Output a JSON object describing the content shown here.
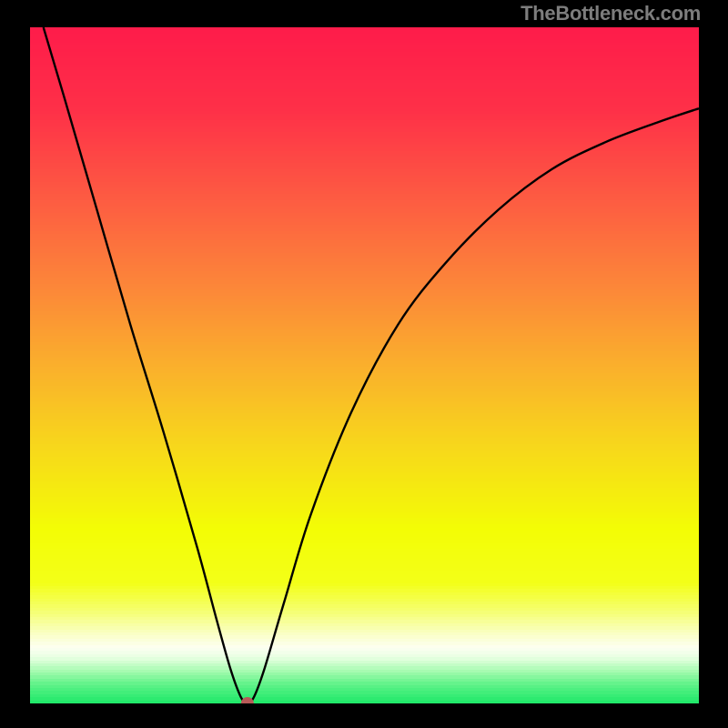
{
  "watermark": "TheBottleneck.com",
  "chart_data": {
    "type": "line",
    "title": "",
    "xlabel": "",
    "ylabel": "",
    "xlim": [
      0,
      100
    ],
    "ylim": [
      0,
      100
    ],
    "grid": false,
    "legend": false,
    "series": [
      {
        "name": "bottleneck-curve",
        "x": [
          2,
          5,
          10,
          15,
          20,
          25,
          28,
          30,
          31.5,
          32.5,
          33.5,
          35,
          38,
          42,
          48,
          55,
          62,
          70,
          78,
          86,
          94,
          100
        ],
        "y": [
          100,
          90,
          73,
          56,
          40,
          23,
          12,
          5,
          1,
          0,
          1,
          5,
          15,
          28,
          43,
          56,
          65,
          73,
          79,
          83,
          86,
          88
        ]
      }
    ],
    "marker": {
      "x": 32.5,
      "y": 0,
      "color": "#b85a58"
    },
    "background_gradient": {
      "description": "vertical gradient red→orange→yellow→pale→green",
      "stops": [
        {
          "pos": 0.0,
          "color": "#fe1c4a"
        },
        {
          "pos": 0.12,
          "color": "#fe3048"
        },
        {
          "pos": 0.25,
          "color": "#fd5b42"
        },
        {
          "pos": 0.38,
          "color": "#fc8639"
        },
        {
          "pos": 0.5,
          "color": "#fab02c"
        },
        {
          "pos": 0.62,
          "color": "#f7d81b"
        },
        {
          "pos": 0.74,
          "color": "#f3fd05"
        },
        {
          "pos": 0.82,
          "color": "#f3ff18"
        },
        {
          "pos": 0.86,
          "color": "#f5ff6e"
        },
        {
          "pos": 0.89,
          "color": "#f9ffba"
        },
        {
          "pos": 0.915,
          "color": "#fdfff2"
        },
        {
          "pos": 0.93,
          "color": "#e6ffe1"
        },
        {
          "pos": 0.95,
          "color": "#a6fbb0"
        },
        {
          "pos": 0.97,
          "color": "#5ef288"
        },
        {
          "pos": 1.0,
          "color": "#17e765"
        }
      ]
    }
  }
}
